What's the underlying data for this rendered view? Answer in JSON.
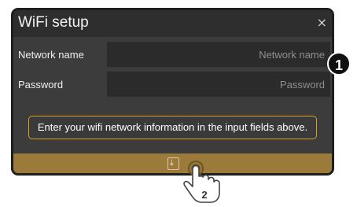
{
  "dialog": {
    "title": "WiFi setup",
    "close_glyph": "×",
    "fields": [
      {
        "label": "Network name",
        "placeholder": "Network name",
        "value": ""
      },
      {
        "label": "Password",
        "placeholder": "Password",
        "value": ""
      }
    ],
    "hint": "Enter your wifi network information in the input fields above.",
    "save_icon": "save-icon"
  },
  "annotations": {
    "step1": "1",
    "step2": "2"
  },
  "colors": {
    "dialog_bg": "#3c3c3c",
    "titlebar_bg": "#2e2e2e",
    "input_bg": "#2b2b2b",
    "hint_border": "#d7a21f",
    "footer_bg": "#9b7a3a"
  }
}
